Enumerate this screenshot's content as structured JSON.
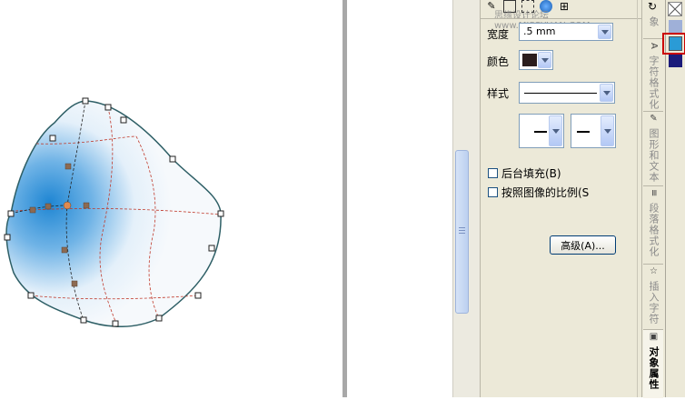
{
  "toolbar": {
    "watermark_text": "思缘设计论坛",
    "watermark_url": "www.MISSYUAN.COM",
    "icons": [
      "pen-icon",
      "outline-icon",
      "fill-icon",
      "globe-icon",
      "grid-icon"
    ]
  },
  "properties": {
    "width_label": "宽度",
    "width_value": ".5 mm",
    "color_label": "颜色",
    "style_label": "样式",
    "behind_fill_label": "后台填充(B)",
    "scale_with_image_label": "按照图像的比例(S",
    "advanced_button_label": "高级(A)..."
  },
  "tabs": {
    "partial_top": "象",
    "char_format": "字符格式化",
    "shape_text": "图形和文本",
    "para_format": "段落格式化",
    "insert_char": "插入字符",
    "object_props": "对象属性"
  },
  "palette": {
    "swatches": [
      "#2a9bd6",
      "#1b1b7a"
    ],
    "selected_highlight": "#cc0000"
  },
  "colors": {
    "outline_swatch": "#2b1d1d",
    "gradient_blue": "#1f86d3",
    "node_color": "#8c6a52"
  }
}
